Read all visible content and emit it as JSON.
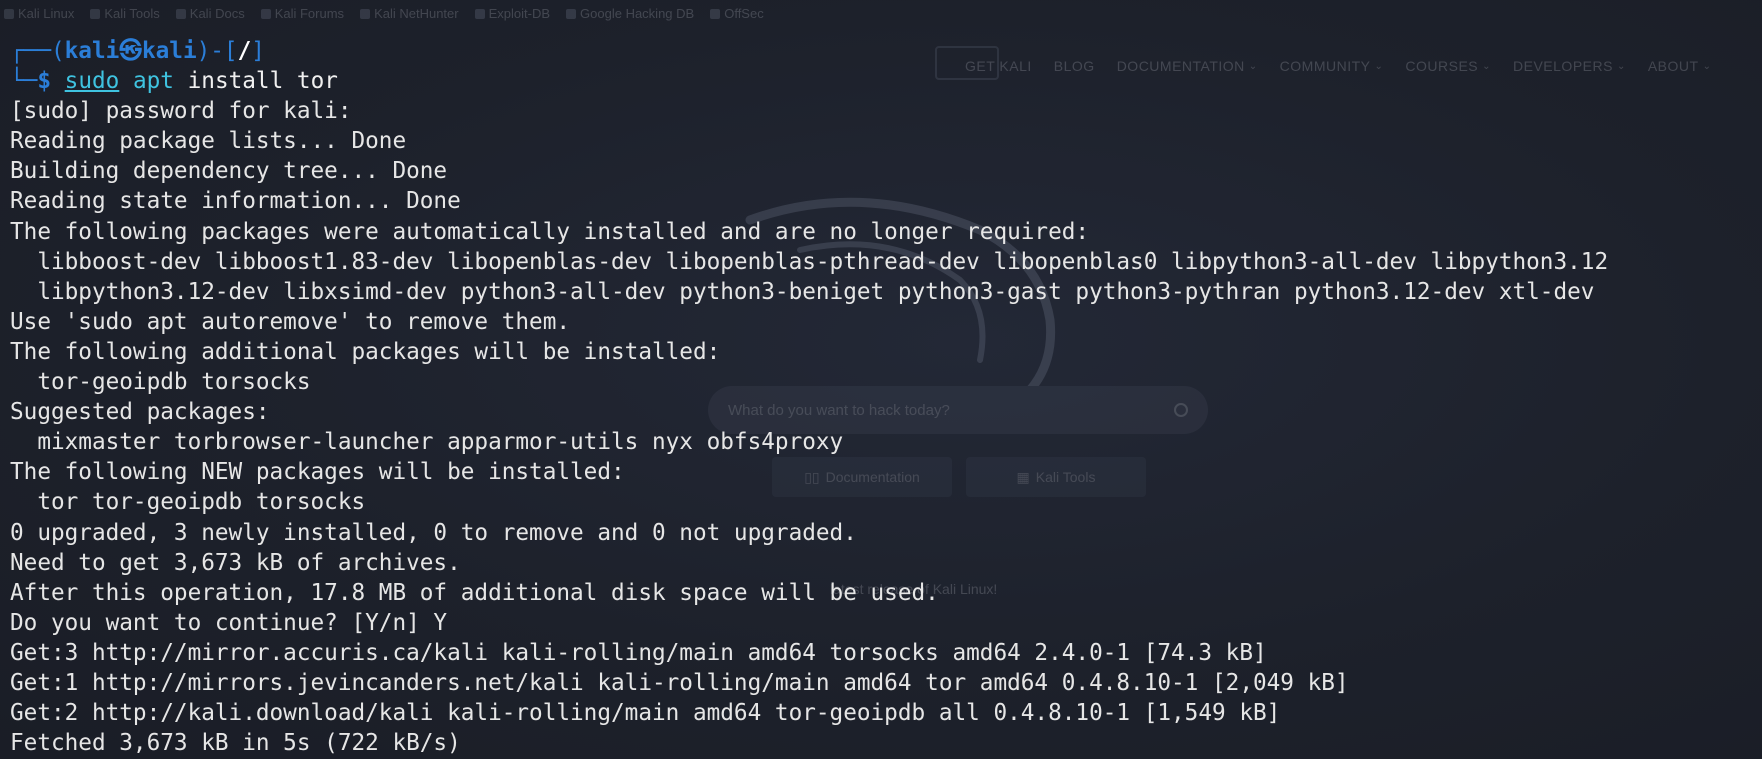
{
  "browser_background": {
    "bookmarks": [
      {
        "label": "Kali Linux",
        "icon": "kali-dragon-icon"
      },
      {
        "label": "Kali Tools",
        "icon": "kali-tools-icon"
      },
      {
        "label": "Kali Docs",
        "icon": "kali-docs-icon"
      },
      {
        "label": "Kali Forums",
        "icon": "kali-forums-icon"
      },
      {
        "label": "Kali NetHunter",
        "icon": "nethunter-icon"
      },
      {
        "label": "Exploit-DB",
        "icon": "exploit-db-icon"
      },
      {
        "label": "Google Hacking DB",
        "icon": "ghdb-icon"
      },
      {
        "label": "OffSec",
        "icon": "offsec-icon"
      }
    ],
    "nav": [
      {
        "label": "GET KALI",
        "dropdown": false
      },
      {
        "label": "BLOG",
        "dropdown": false
      },
      {
        "label": "DOCUMENTATION",
        "dropdown": true
      },
      {
        "label": "COMMUNITY",
        "dropdown": true
      },
      {
        "label": "COURSES",
        "dropdown": true
      },
      {
        "label": "DEVELOPERS",
        "dropdown": true
      },
      {
        "label": "ABOUT",
        "dropdown": true
      }
    ],
    "search_placeholder": "What do you want to hack today?",
    "buttons": [
      "Documentation",
      "Kali Tools"
    ],
    "release_text": "latest release of Kali Linux!"
  },
  "terminal": {
    "prompt": {
      "frame_top": "┌──(",
      "user": "kali",
      "at_symbol": "㉿",
      "host": "kali",
      "frame_mid": ")-[",
      "path": "/",
      "frame_end": "]",
      "frame_bottom": "└─",
      "dollar": "$",
      "cmd_sudo": "sudo",
      "cmd_apt": "apt",
      "cmd_rest": "install tor"
    },
    "output_lines": [
      "[sudo] password for kali:",
      "Reading package lists... Done",
      "Building dependency tree... Done",
      "Reading state information... Done",
      "The following packages were automatically installed and are no longer required:",
      "  libboost-dev libboost1.83-dev libopenblas-dev libopenblas-pthread-dev libopenblas0 libpython3-all-dev libpython3.12",
      "  libpython3.12-dev libxsimd-dev python3-all-dev python3-beniget python3-gast python3-pythran python3.12-dev xtl-dev",
      "Use 'sudo apt autoremove' to remove them.",
      "The following additional packages will be installed:",
      "  tor-geoipdb torsocks",
      "Suggested packages:",
      "  mixmaster torbrowser-launcher apparmor-utils nyx obfs4proxy",
      "The following NEW packages will be installed:",
      "  tor tor-geoipdb torsocks",
      "0 upgraded, 3 newly installed, 0 to remove and 0 not upgraded.",
      "Need to get 3,673 kB of archives.",
      "After this operation, 17.8 MB of additional disk space will be used.",
      "Do you want to continue? [Y/n] Y",
      "Get:3 http://mirror.accuris.ca/kali kali-rolling/main amd64 torsocks amd64 2.4.0-1 [74.3 kB]",
      "Get:1 http://mirrors.jevincanders.net/kali kali-rolling/main amd64 tor amd64 0.4.8.10-1 [2,049 kB]",
      "Get:2 http://kali.download/kali kali-rolling/main amd64 tor-geoipdb all 0.4.8.10-1 [1,549 kB]",
      "Fetched 3,673 kB in 5s (722 kB/s)"
    ]
  },
  "colors": {
    "prompt_blue": "#2b7ed8",
    "command_cyan": "#3fc3e0",
    "text": "#e6e6e6",
    "background": "#1c2029"
  }
}
